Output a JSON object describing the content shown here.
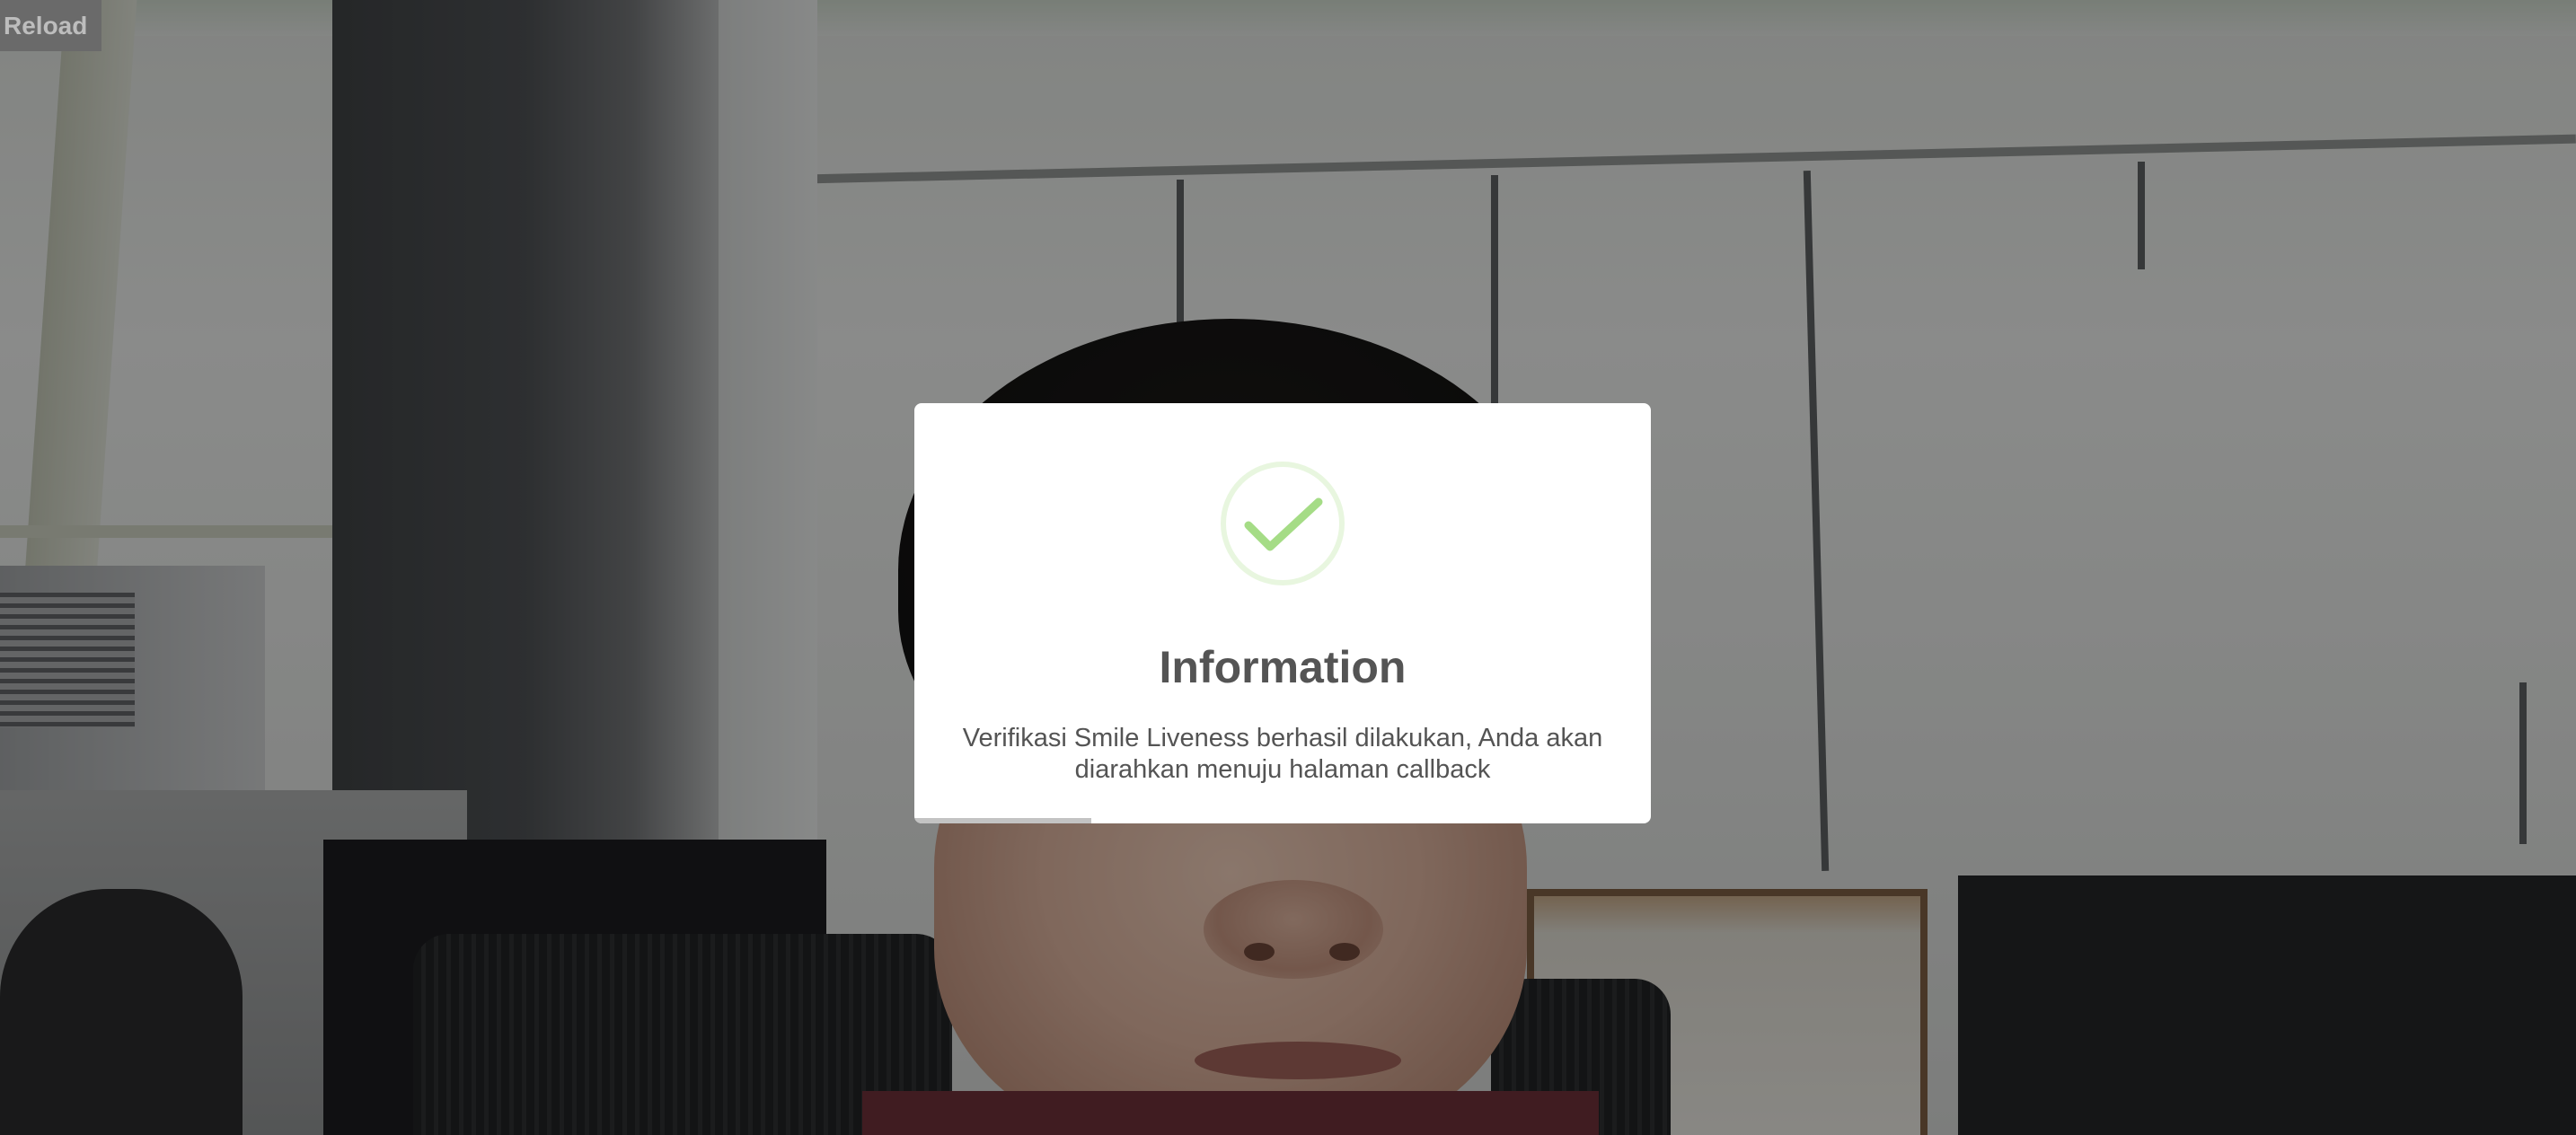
{
  "toolbar": {
    "reload_label": "Reload"
  },
  "modal": {
    "icon": "success-check-icon",
    "title": "Information",
    "message": "Verifikasi Smile Liveness berhasil dilakukan, Anda akan diarahkan menuju halaman callback",
    "timer_progress": 0.24
  },
  "colors": {
    "success_green": "#a5dc86",
    "success_ring": "#e8f6df",
    "title_text": "#545454",
    "reload_bg": "#6a6a6a",
    "reload_text": "#bdbdbd",
    "timer_bar": "#c3c3c3"
  }
}
